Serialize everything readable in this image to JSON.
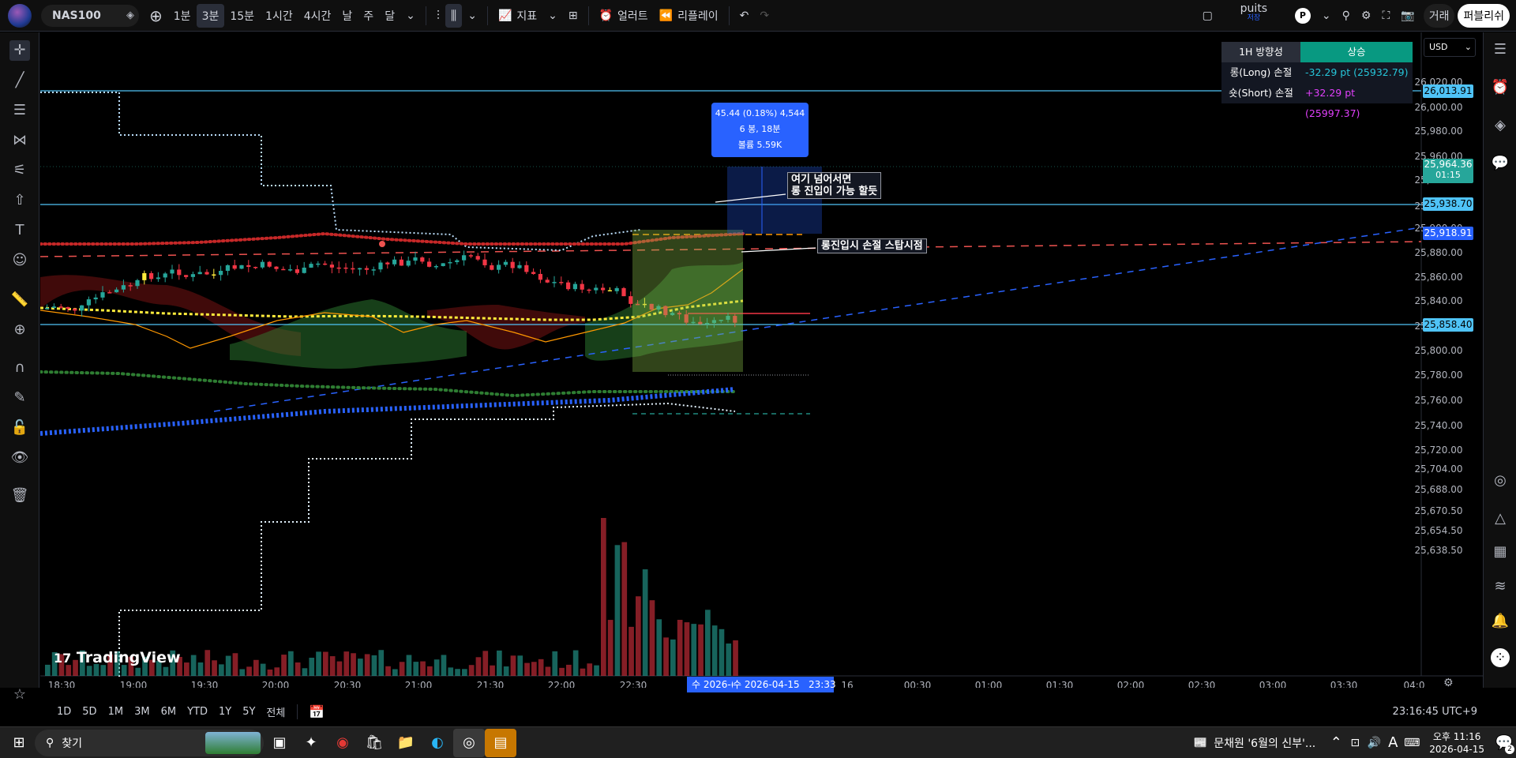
{
  "topbar": {
    "symbol": "NAS100",
    "intervals": [
      "1분",
      "3분",
      "15분",
      "1시간",
      "4시간",
      "날",
      "주",
      "달"
    ],
    "active_interval": "3분",
    "indicators": "지표",
    "alert": "얼러트",
    "replay": "리플레이",
    "user": "puits",
    "user_sub": "저장",
    "avatar": "P",
    "trade": "거래",
    "publish": "퍼블리쉬"
  },
  "currency": "USD",
  "infobox": {
    "rows": [
      {
        "k": "1H 방향성",
        "v": "상승"
      },
      {
        "k": "롱(Long) 손절",
        "v": "-32.29 pt (25932.79)"
      },
      {
        "k": "숏(Short) 손절",
        "v": "+32.29 pt (25997.37)"
      }
    ],
    "colors": {
      "up": "#089981",
      "long": "#26c6da",
      "short": "#e040fb"
    }
  },
  "price_axis": {
    "ticks": [
      "26,020.00",
      "26,000.00",
      "25,980.00",
      "25,960.00",
      "25,940.00",
      "25,920.00",
      "25,900.00",
      "25,880.00",
      "25,860.00",
      "25,840.00",
      "25,820.00",
      "25,800.00",
      "25,780.00",
      "25,760.00",
      "25,740.00",
      "25,720.00",
      "25,704.00",
      "25,688.00",
      "25,670.50",
      "25,654.50",
      "25,638.50"
    ],
    "labels": [
      {
        "text": "26,013.91",
        "color": "#4fc3f7"
      },
      {
        "text": "25,964.36",
        "sub": "01:15",
        "color": "#26a69a"
      },
      {
        "text": "25,938.70",
        "color": "#4fc3f7"
      },
      {
        "text": "25,918.91",
        "color": "#2962ff"
      },
      {
        "text": "25,858.40",
        "color": "#4fc3f7"
      }
    ]
  },
  "time_axis": {
    "ticks": [
      "18:30",
      "19:00",
      "19:30",
      "20:00",
      "20:30",
      "21:00",
      "21:30",
      "22:00",
      "22:30",
      "수 2026-04-15",
      "16",
      "00:30",
      "01:00",
      "01:30",
      "02:00",
      "02:30",
      "03:00",
      "03:30",
      "04:0"
    ],
    "cursor": "수 2026-04-15   23:33",
    "left_label": "수 2026-("
  },
  "measure": {
    "line1": "45.44 (0.18%) 4,544",
    "line2": "6 봉, 18분",
    "line3": "볼륨 5.59K"
  },
  "notes": {
    "note1_line1": "여기 넘어서면",
    "note1_line2": "롱 진입이 가능 할듯",
    "note2": "롱진입시 손절 스탑시점"
  },
  "watermark": "TradingView",
  "ranges": [
    "1D",
    "5D",
    "1M",
    "3M",
    "6M",
    "YTD",
    "1Y",
    "5Y",
    "전체"
  ],
  "clock": "23:16:45 UTC+9",
  "taskbar": {
    "search": "찾기",
    "song": "문채원 '6월의 신부'...",
    "time": "오후 11:16",
    "date": "2026-04-15",
    "lang": "A",
    "badge": "2"
  }
}
